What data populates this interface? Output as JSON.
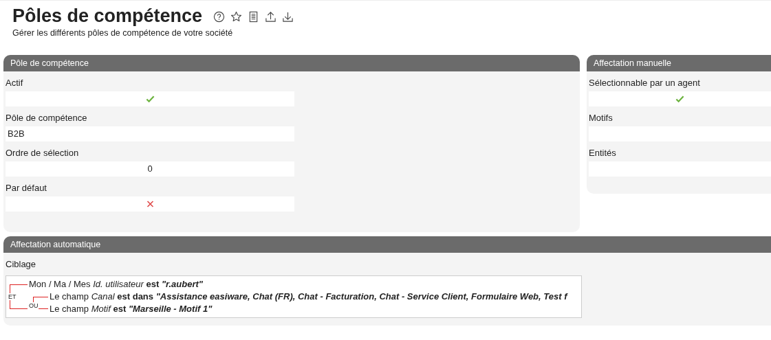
{
  "page": {
    "title": "Pôles de compétence",
    "subtitle": "Gérer les différents pôles de compétence de votre société"
  },
  "toolbar": [
    {
      "kind": "help"
    },
    {
      "kind": "star"
    },
    {
      "kind": "document"
    },
    {
      "kind": "upload"
    },
    {
      "kind": "download"
    }
  ],
  "skill_panel": {
    "title": "Pôle de compétence",
    "fields": [
      {
        "label": "Actif",
        "kind": "boolean",
        "value": true
      },
      {
        "label": "Pôle de compétence",
        "kind": "text",
        "value": "B2B"
      },
      {
        "label": "Ordre de sélection",
        "kind": "number",
        "value": "0"
      },
      {
        "label": "Par défaut",
        "kind": "boolean",
        "value": false
      }
    ]
  },
  "manual_panel": {
    "title": "Affectation manuelle",
    "fields": [
      {
        "label": "Sélectionnable par un agent",
        "kind": "boolean",
        "value": true
      },
      {
        "label": "Motifs",
        "kind": "text"
      },
      {
        "label": "Entités",
        "kind": "text"
      }
    ]
  },
  "auto_panel": {
    "title": "Affectation automatique",
    "targeting": {
      "label": "Ciblage",
      "rule": {
        "kind": "group",
        "operator": "ET",
        "children": [
          {
            "kind": "condition",
            "prefix": "Mon / Ma / Mes",
            "field": "Id. utilisateur",
            "operator": "est",
            "value": "\"r.aubert\""
          },
          {
            "kind": "group",
            "operator": "OU",
            "children": [
              {
                "kind": "condition",
                "prefix": "Le champ",
                "field": "Canal",
                "operator": "est dans",
                "value": "\"Assistance easiware, Chat (FR), Chat - Facturation, Chat - Service Client, Formulaire Web, Test f"
              },
              {
                "kind": "condition",
                "prefix": "Le champ",
                "field": "Motif",
                "operator": "est",
                "value": "\"Marseille - Motif 1\""
              }
            ]
          }
        ]
      }
    }
  }
}
